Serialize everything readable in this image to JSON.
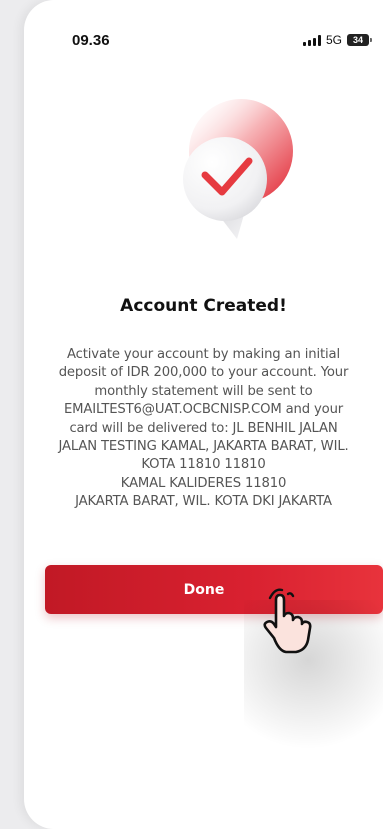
{
  "status_bar": {
    "time": "09.36",
    "network": "5G",
    "battery": "34",
    "signal_icon": "signal-bars-icon",
    "battery_icon": "battery-icon"
  },
  "illustration": {
    "icon": "checkmark-icon",
    "accent_color": "#e63a40"
  },
  "screen": {
    "title": "Account Created!",
    "message_lines": [
      "Activate your account by making an initial",
      "deposit of IDR 200,000 to your account. Your",
      "monthly statement will be sent to",
      "EMAILTEST6@UAT.OCBCNISP.COM and your",
      "card will be delivered to: JL BENHIL JALAN",
      "JALAN TESTING KAMAL, JAKARTA BARAT, WIL.",
      "KOTA 11810 11810",
      "KAMAL KALIDERES 11810",
      "JAKARTA BARAT, WIL. KOTA DKI JAKARTA"
    ]
  },
  "actions": {
    "done_label": "Done",
    "button_color": "#d4202c"
  },
  "cursor": {
    "icon": "hand-pointer-icon"
  }
}
